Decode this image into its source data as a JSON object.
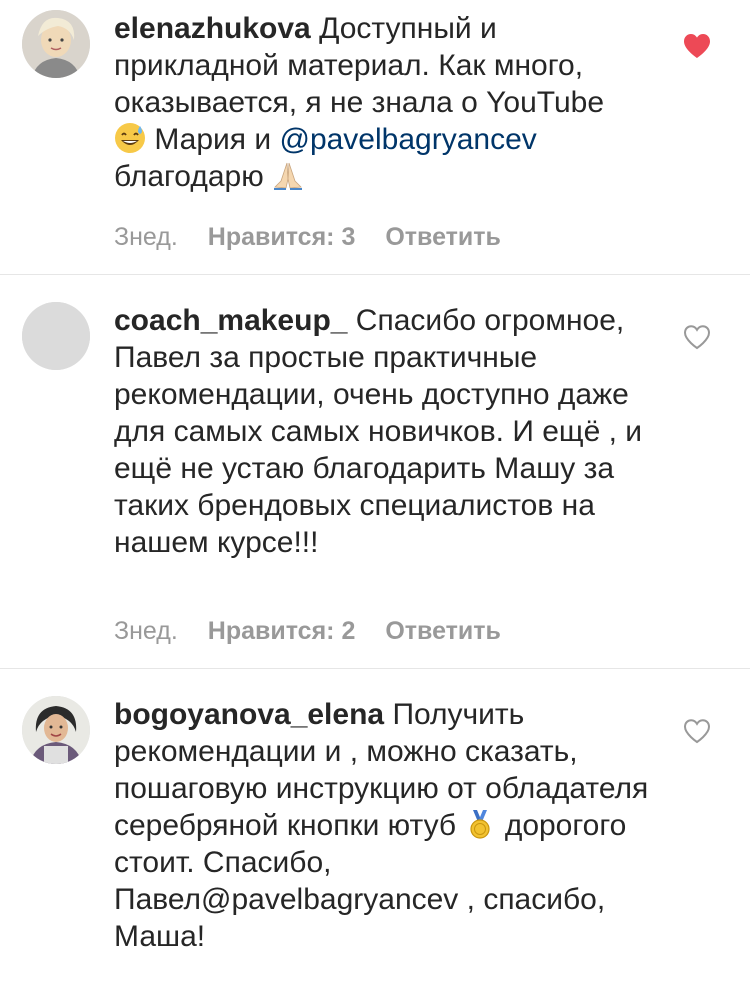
{
  "comments": [
    {
      "username": "elenazhukova",
      "text_1": "Доступный и прикладной материал. Как много, оказывается, я не знала о YouTube",
      "text_2": "Мария и",
      "mention": "@pavelbagryancev",
      "text_3": "благодарю",
      "emoji_1": "sweat-smile-emoji",
      "emoji_2": "praying-hands-emoji",
      "time": "Знед.",
      "likes": "Нравится: 3",
      "reply": "Ответить",
      "liked": true,
      "heart_color": "#ed4956"
    },
    {
      "username": "coach_makeup_",
      "text": "Спасибо огромное, Павел за простые практичные рекомендации, очень доступно даже для самых самых новичков. И ещё , и ещё не устаю благодарить Машу за таких брендовых  специалистов на нашем курсе!!!",
      "time": "Знед.",
      "likes": "Нравится: 2",
      "reply": "Ответить",
      "liked": false
    },
    {
      "username": "bogoyanova_elena",
      "text_1": "Получить рекомендации и , можно сказать, пошаговую инструкцию от обладателя серебряной кнопки ютуб",
      "emoji": "medal-emoji",
      "text_2": "дорогого стоит. Спасибо, Павел@pavelbagryancev , спасибо, Маша!",
      "liked": false
    }
  ],
  "colors": {
    "text": "#262626",
    "secondary": "#999999",
    "mention": "#003569",
    "divider": "#e6e6e6",
    "heart_active": "#ed4956"
  }
}
